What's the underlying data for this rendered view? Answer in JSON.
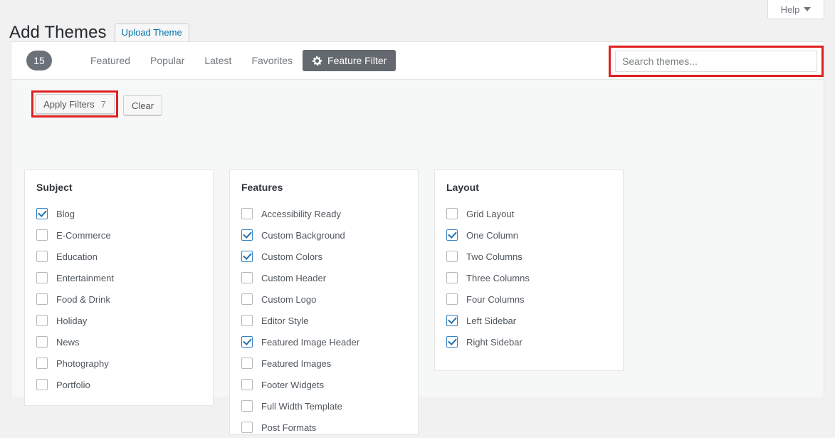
{
  "header": {
    "title": "Add Themes",
    "upload_label": "Upload Theme",
    "help_label": "Help"
  },
  "toolbar": {
    "count_badge": "15",
    "tabs": [
      {
        "label": "Featured",
        "active": false
      },
      {
        "label": "Popular",
        "active": false
      },
      {
        "label": "Latest",
        "active": false
      },
      {
        "label": "Favorites",
        "active": false
      },
      {
        "label": "Feature Filter",
        "active": true,
        "icon": "gear-icon"
      }
    ],
    "search": {
      "placeholder": "Search themes...",
      "value": "",
      "highlighted": true,
      "highlight_color": "#e02020"
    }
  },
  "filters": {
    "apply_label": "Apply Filters",
    "apply_count": "7",
    "apply_highlighted": true,
    "clear_label": "Clear",
    "groups": [
      {
        "title": "Subject",
        "options": [
          {
            "label": "Blog",
            "checked": true
          },
          {
            "label": "E-Commerce",
            "checked": false
          },
          {
            "label": "Education",
            "checked": false
          },
          {
            "label": "Entertainment",
            "checked": false
          },
          {
            "label": "Food & Drink",
            "checked": false
          },
          {
            "label": "Holiday",
            "checked": false
          },
          {
            "label": "News",
            "checked": false
          },
          {
            "label": "Photography",
            "checked": false
          },
          {
            "label": "Portfolio",
            "checked": false
          }
        ]
      },
      {
        "title": "Features",
        "options": [
          {
            "label": "Accessibility Ready",
            "checked": false
          },
          {
            "label": "Custom Background",
            "checked": true
          },
          {
            "label": "Custom Colors",
            "checked": true
          },
          {
            "label": "Custom Header",
            "checked": false
          },
          {
            "label": "Custom Logo",
            "checked": false
          },
          {
            "label": "Editor Style",
            "checked": false
          },
          {
            "label": "Featured Image Header",
            "checked": true
          },
          {
            "label": "Featured Images",
            "checked": false
          },
          {
            "label": "Footer Widgets",
            "checked": false
          },
          {
            "label": "Full Width Template",
            "checked": false
          },
          {
            "label": "Post Formats",
            "checked": false
          }
        ]
      },
      {
        "title": "Layout",
        "options": [
          {
            "label": "Grid Layout",
            "checked": false
          },
          {
            "label": "One Column",
            "checked": true
          },
          {
            "label": "Two Columns",
            "checked": false
          },
          {
            "label": "Three Columns",
            "checked": false
          },
          {
            "label": "Four Columns",
            "checked": false
          },
          {
            "label": "Left Sidebar",
            "checked": true
          },
          {
            "label": "Right Sidebar",
            "checked": true
          }
        ]
      }
    ]
  },
  "colors": {
    "accent_blue": "#0073aa",
    "checkbox_blue": "#2271b1",
    "active_tab_bg": "#646970",
    "badge_bg": "#6c7079",
    "highlight_red": "#e02020"
  }
}
